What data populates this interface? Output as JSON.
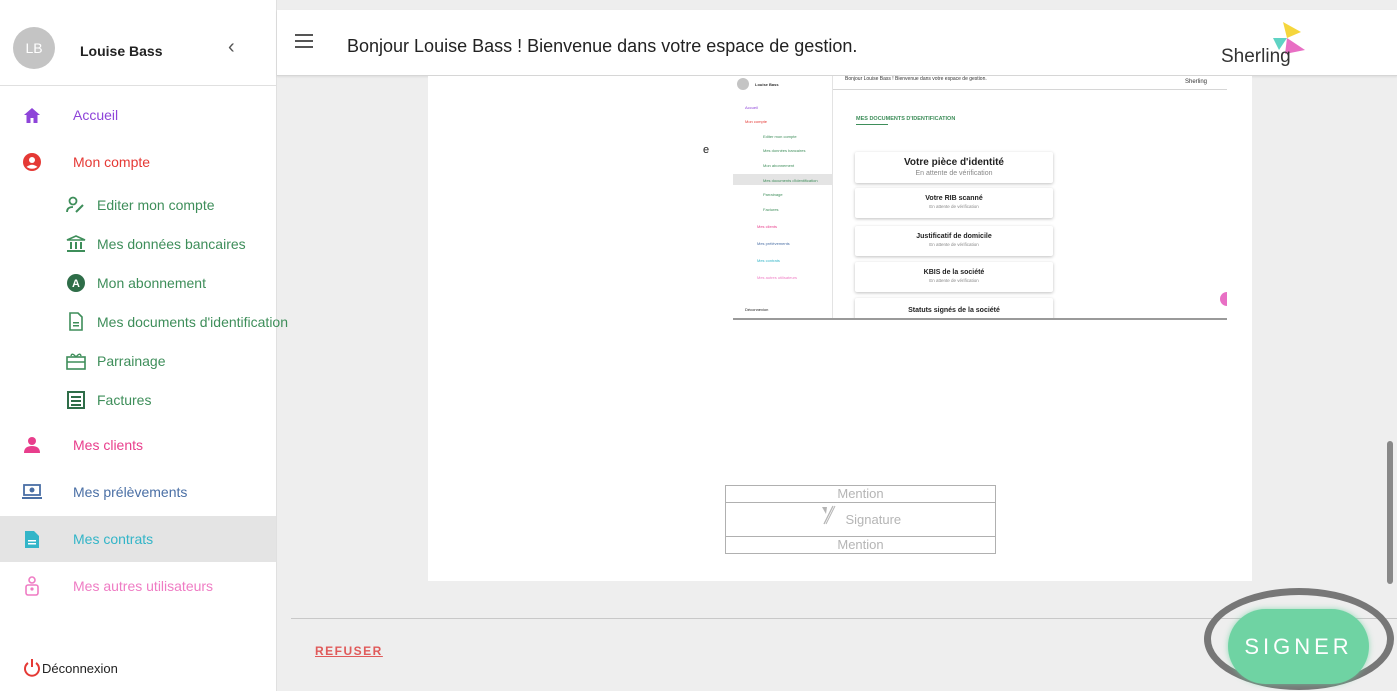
{
  "sidebar": {
    "avatar_initials": "LB",
    "user_name": "Louise Bass",
    "collapse_icon": "chevron-left-icon",
    "items": {
      "accueil": {
        "label": "Accueil",
        "color": "#8e44d9",
        "icon": "home-icon"
      },
      "mon_compte": {
        "label": "Mon compte",
        "color": "#e53935",
        "icon": "account-circle-icon"
      },
      "mes_clients": {
        "label": "Mes clients",
        "color": "#e83e8c",
        "icon": "clients-icon"
      },
      "mes_prelevements": {
        "label": "Mes prélèvements",
        "color": "#4a6fa5",
        "icon": "payment-icon"
      },
      "mes_contrats": {
        "label": "Mes contrats",
        "color": "#33b5c8",
        "icon": "document-icon"
      },
      "mes_autres_utilisateurs": {
        "label": "Mes autres utilisateurs",
        "color": "#ef7cc4",
        "icon": "user-badge-icon"
      },
      "deconnexion": {
        "label": "Déconnexion",
        "color": "#e53935",
        "icon": "power-icon"
      }
    },
    "sub_items": [
      {
        "label": "Editer mon compte",
        "icon": "user-edit-icon"
      },
      {
        "label": "Mes données bancaires",
        "icon": "bank-icon"
      },
      {
        "label": "Mon abonnement",
        "icon": "subscription-icon"
      },
      {
        "label": "Mes documents d'identification",
        "icon": "file-icon"
      },
      {
        "label": "Parrainage",
        "icon": "gift-icon"
      },
      {
        "label": "Factures",
        "icon": "invoice-icon"
      }
    ],
    "sub_color": "#3e8e5a"
  },
  "header": {
    "greeting": "Bonjour Louise Bass ! Bienvenue dans votre espace de gestion.",
    "logo_text": "Sherling"
  },
  "document": {
    "stray_char": "e",
    "embedded": {
      "user_name": "Louise Bass",
      "greeting": "Bonjour Louise Bass ! Bienvenue dans votre espace de gestion.",
      "logo_text": "Sherling",
      "nav": [
        "Accueil",
        "Mon compte",
        "Editer mon compte",
        "Mes données bancaires",
        "Mon abonnement",
        "Mes documents d'identification",
        "Parrainage",
        "Factures",
        "Mes clients",
        "Mes prélèvements",
        "Mes contrats",
        "Mes autres utilisateurs",
        "Déconnexion"
      ],
      "section_title": "MES DOCUMENTS D'IDENTIFICATION",
      "cards": [
        {
          "title": "Votre pièce d'identité",
          "status": "En attente de vérification"
        },
        {
          "title": "Votre RIB scanné",
          "status": "En attente de vérification"
        },
        {
          "title": "Justificatif de domicile",
          "status": "En attente de vérification"
        },
        {
          "title": "KBIS de la société",
          "status": "En attente de vérification"
        },
        {
          "title": "Statuts signés de la société",
          "status": ""
        }
      ]
    },
    "signature_block": {
      "mention_top": "Mention",
      "signature": "Signature",
      "mention_bottom": "Mention"
    }
  },
  "footer": {
    "refuse_label": "REFUSER",
    "sign_label": "SIGNER",
    "sign_color": "#6fd3a3"
  }
}
